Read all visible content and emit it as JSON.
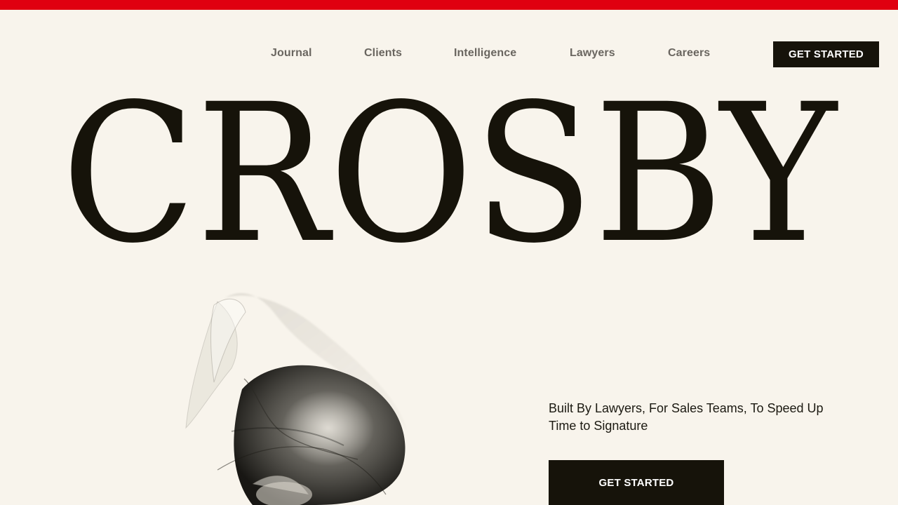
{
  "brand": {
    "name": "CROSBY",
    "accent_color": "#e00010",
    "dark_color": "#16130a",
    "background_color": "#f8f4ec"
  },
  "nav": {
    "links": [
      {
        "label": "Journal"
      },
      {
        "label": "Clients"
      },
      {
        "label": "Intelligence"
      },
      {
        "label": "Lawyers"
      },
      {
        "label": "Careers"
      }
    ],
    "cta_label": "GET STARTED"
  },
  "hero": {
    "art_icon": "abstract-ribbon-art",
    "tagline": "Built By Lawyers, For Sales Teams, To Speed Up Time to Signature",
    "cta_label": "GET STARTED"
  }
}
